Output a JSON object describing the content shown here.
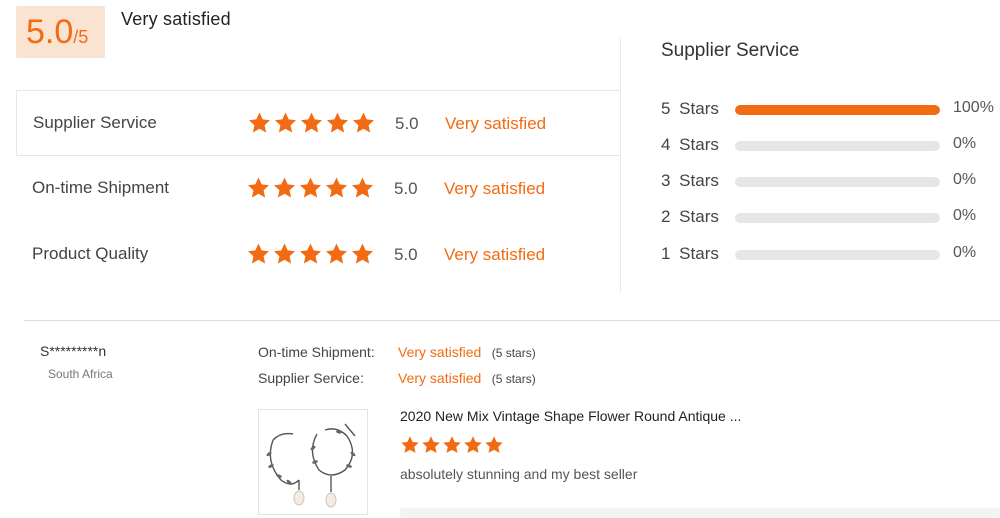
{
  "summary": {
    "score": "5.0",
    "score_max": "/5",
    "label": "Very satisfied"
  },
  "ratings": [
    {
      "label": "Supplier Service",
      "stars": 5,
      "score": "5.0",
      "sentiment": "Very satisfied"
    },
    {
      "label": "On-time Shipment",
      "stars": 5,
      "score": "5.0",
      "sentiment": "Very satisfied"
    },
    {
      "label": "Product Quality",
      "stars": 5,
      "score": "5.0",
      "sentiment": "Very satisfied"
    }
  ],
  "distribution": {
    "title": "Supplier Service",
    "rows": [
      {
        "label": "5 Stars",
        "percent": 100,
        "percent_label": "100%"
      },
      {
        "label": "4 Stars",
        "percent": 0,
        "percent_label": "0%"
      },
      {
        "label": "3 Stars",
        "percent": 0,
        "percent_label": "0%"
      },
      {
        "label": "2 Stars",
        "percent": 0,
        "percent_label": "0%"
      },
      {
        "label": "1 Stars",
        "percent": 0,
        "percent_label": "0%"
      }
    ]
  },
  "review": {
    "reviewer": "S*********n",
    "country": "South Africa",
    "shipment_label": "On-time Shipment:",
    "shipment_sentiment": "Very satisfied",
    "shipment_count": "(5 stars)",
    "service_label": "Supplier Service:",
    "service_sentiment": "Very satisfied",
    "service_count": "(5 stars)",
    "product_title": "2020 New Mix Vintage Shape Flower Round Antique ...",
    "stars": 5,
    "text": "absolutely stunning and my best seller",
    "thumbnail_icon": "earring-product-image"
  },
  "colors": {
    "accent": "#f26b12",
    "score_bg": "#fbe3d2",
    "track": "#e6e6e6"
  }
}
